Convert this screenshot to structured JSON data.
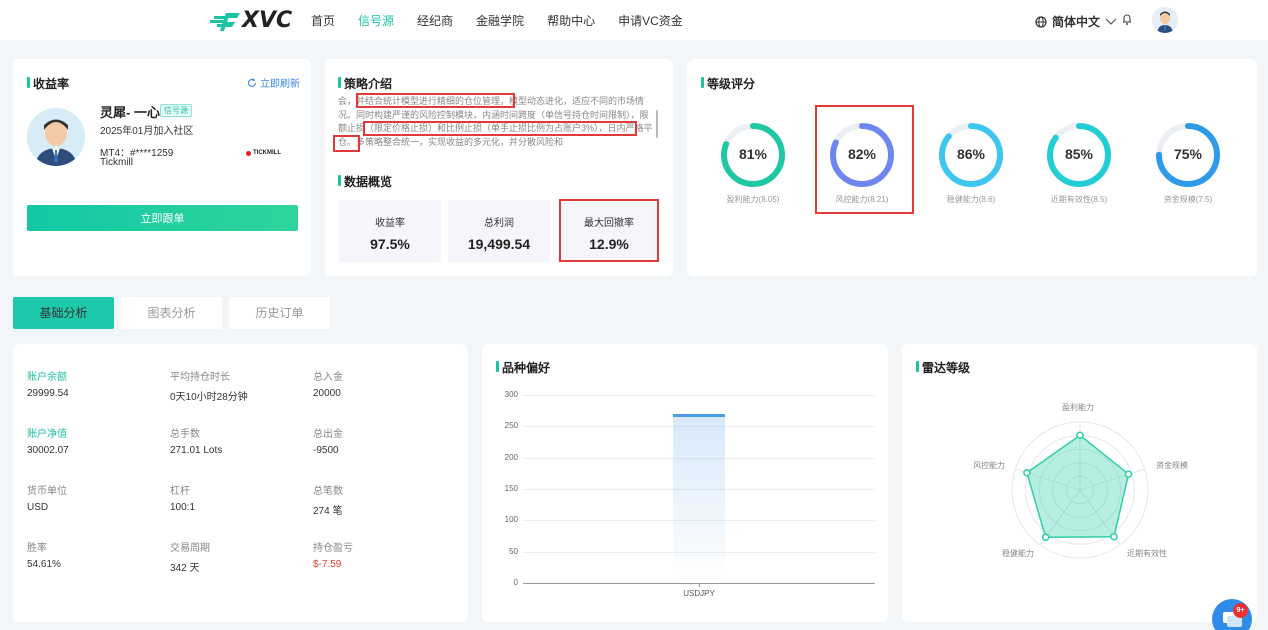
{
  "nav": {
    "logo": "XVC",
    "links": [
      "首页",
      "信号源",
      "经纪商",
      "金融学院",
      "帮助中心",
      "申请VC资金"
    ],
    "active_index": 1,
    "language": "简体中文"
  },
  "profile": {
    "section_title": "收益率",
    "refresh_label": "立即刷新",
    "name": "灵犀- 一心",
    "tag": "信号源",
    "joined": "2025年01月加入社区",
    "mt4": "MT4：#****1259",
    "broker": "Tickmill",
    "broker_logo": "TICKMILL",
    "follow_button": "立即跟单"
  },
  "strategy": {
    "section_title": "策略介绍",
    "text": "会，并结合统计模型进行精细的仓位管理，模型动态进化，适应不同的市场情况。同时构建严谨的风险控制模块，内涵时间跨度（单信号持仓时间限制），限额止损（限定价格止损）和比例止损（单手止损比例为占账户3%），日内严格平仓。多策略整合统一，实现收益的多元化，并分散风险和"
  },
  "overview": {
    "section_title": "数据概览",
    "stats": [
      {
        "label": "收益率",
        "value": "97.5%"
      },
      {
        "label": "总利润",
        "value": "19,499.54"
      },
      {
        "label": "最大回撤率",
        "value": "12.9%"
      }
    ]
  },
  "grades": {
    "section_title": "等级评分",
    "items": [
      {
        "pct": "81%",
        "fraction": 0.81,
        "label": "盈利能力(8.05)",
        "color": "#1fc8a2"
      },
      {
        "pct": "82%",
        "fraction": 0.82,
        "label": "风控能力(8.21)",
        "color": "#6e86f0"
      },
      {
        "pct": "86%",
        "fraction": 0.86,
        "label": "稳健能力(8.6)",
        "color": "#3ec6f0"
      },
      {
        "pct": "85%",
        "fraction": 0.85,
        "label": "近期有效性(8.5)",
        "color": "#22cdd6"
      },
      {
        "pct": "75%",
        "fraction": 0.75,
        "label": "资金规模(7.5)",
        "color": "#2e9bea"
      }
    ]
  },
  "tabs": [
    "基础分析",
    "图表分析",
    "历史订单"
  ],
  "account": {
    "items": [
      {
        "label": "账户余额",
        "value": "29999.54",
        "green": true
      },
      {
        "label": "平均持仓时长",
        "value": "0天10小时28分钟"
      },
      {
        "label": "总入金",
        "value": "20000"
      },
      {
        "label": "账户净值",
        "value": "30002.07",
        "green": true
      },
      {
        "label": "总手数",
        "value": "271.01 Lots"
      },
      {
        "label": "总出金",
        "value": "-9500"
      },
      {
        "label": "货币单位",
        "value": "USD"
      },
      {
        "label": "杠杆",
        "value": "100:1"
      },
      {
        "label": "总笔数",
        "value": "274 笔"
      },
      {
        "label": "胜率",
        "value": "54.61%"
      },
      {
        "label": "交易周期",
        "value": "342 天"
      },
      {
        "label": "持仓盈亏",
        "value": "$-7.59",
        "red": true
      }
    ]
  },
  "preference": {
    "section_title": "品种偏好"
  },
  "chart_data": {
    "type": "bar",
    "categories": [
      "USDJPY"
    ],
    "values": [
      270
    ],
    "title": "品种偏好",
    "xlabel": "",
    "ylabel": "",
    "ylim": [
      0,
      300
    ],
    "yticks": [
      300,
      250,
      200,
      150,
      100,
      50,
      0
    ],
    "color": "#4a9be8"
  },
  "radar": {
    "section_title": "雷达等级",
    "labels": [
      "盈利能力",
      "资金规模",
      "近期有效性",
      "稳健能力",
      "风控能力"
    ],
    "values": [
      8.05,
      7.5,
      8.5,
      8.6,
      8.21
    ],
    "max": 10,
    "color": "#2fcfa8"
  },
  "chat_badge": "9+"
}
